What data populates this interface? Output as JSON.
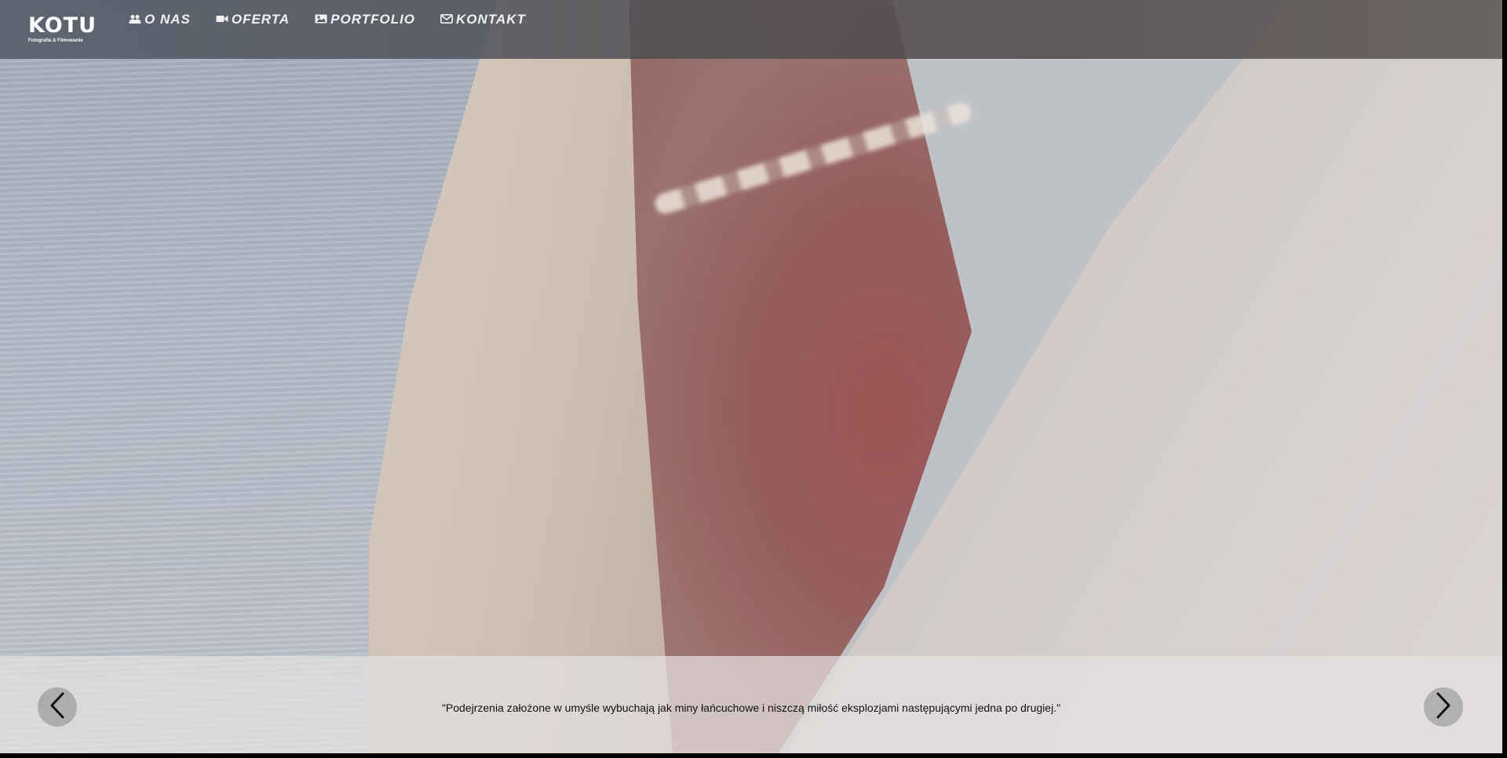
{
  "logo": {
    "text": "KOTU",
    "subtitle": "Fotografia & Filmowanie"
  },
  "nav": {
    "items": [
      {
        "label": "O NAS",
        "icon": "users-icon"
      },
      {
        "label": "OFERTA",
        "icon": "video-camera-icon"
      },
      {
        "label": "PORTFOLIO",
        "icon": "image-icon"
      },
      {
        "label": "KONTAKT",
        "icon": "envelope-icon"
      }
    ]
  },
  "slider": {
    "quote": "\"Podejrzenia założone w umyśle wybuchają jak miny łańcuchowe i niszczą miłość eksplozjami następującymi jedna po drugiej.\"",
    "prev_icon": "chevron-left-icon",
    "next_icon": "chevron-right-icon"
  },
  "colors": {
    "nav_text": "#f2f2f2",
    "topbar": "#545760",
    "caption_bar": "#e4e2e2"
  }
}
